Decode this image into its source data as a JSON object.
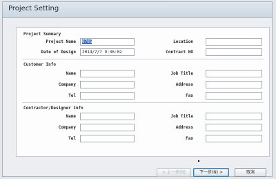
{
  "window": {
    "title": "Project Setting"
  },
  "project_summary": {
    "header": "Project Summary",
    "project_name": {
      "label": "Project Name",
      "value": "0705"
    },
    "location": {
      "label": "Location",
      "value": ""
    },
    "date_of_design": {
      "label": "Date of Design",
      "value": "2014/7/7 9:36:02"
    },
    "contract_no": {
      "label": "Contract NO",
      "value": ""
    }
  },
  "customer_info": {
    "header": "Customer Info",
    "name": {
      "label": "Name",
      "value": ""
    },
    "job_title": {
      "label": "Job Title",
      "value": ""
    },
    "company": {
      "label": "Company",
      "value": ""
    },
    "address": {
      "label": "Address",
      "value": ""
    },
    "tel": {
      "label": "Tel",
      "value": ""
    },
    "fax": {
      "label": "Fax",
      "value": ""
    }
  },
  "contractor_info": {
    "header": "Contractor/Designer Info",
    "name": {
      "label": "Name",
      "value": ""
    },
    "job_title": {
      "label": "Job Title",
      "value": ""
    },
    "company": {
      "label": "Company",
      "value": ""
    },
    "address": {
      "label": "Address",
      "value": ""
    },
    "tel": {
      "label": "Tel",
      "value": ""
    },
    "fax": {
      "label": "Fax",
      "value": ""
    }
  },
  "buttons": {
    "back": "< 上一步(B)",
    "next": "下一步(N) >",
    "cancel": "取消"
  },
  "colors": {
    "selection": "#3a6fc4",
    "focus_border": "#3c7fb1"
  }
}
